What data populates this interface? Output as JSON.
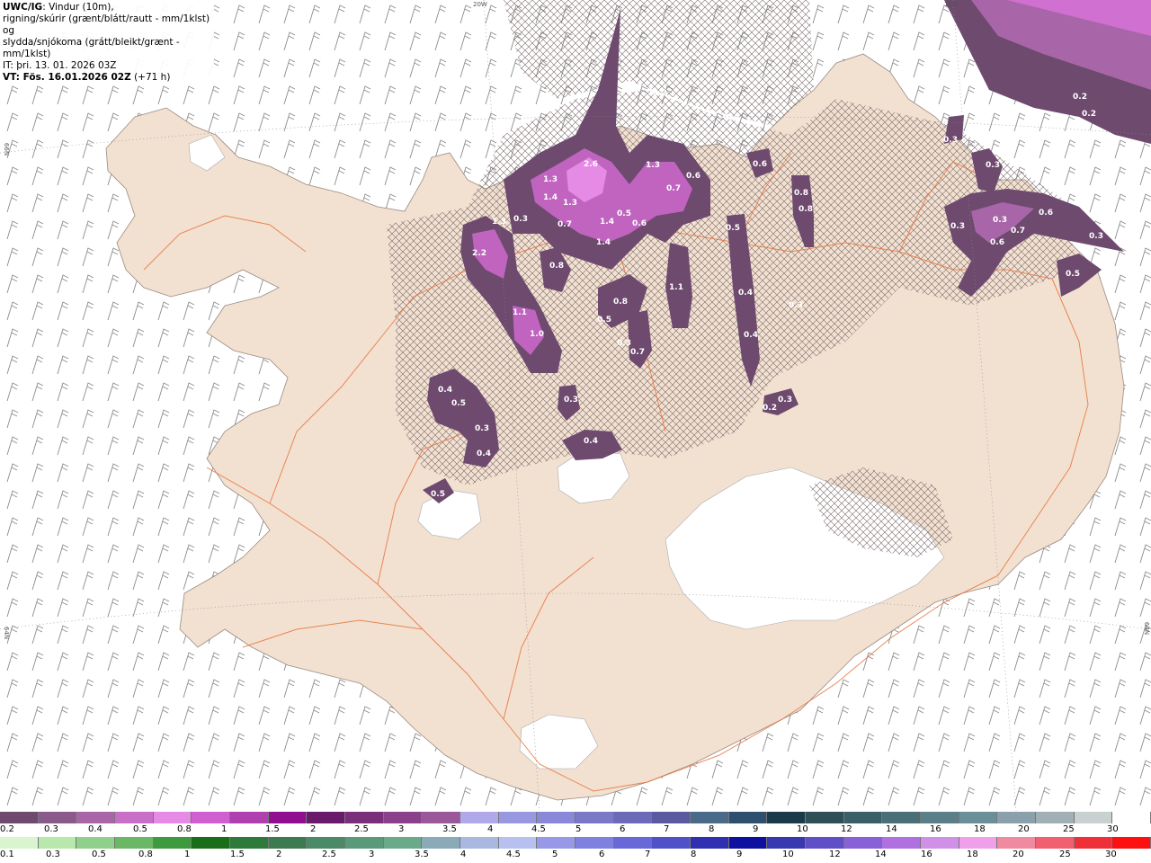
{
  "header": {
    "title_bold": "UWC/IG",
    "title_rest": ": Vindur (10m),",
    "line2": "rigning/skúrir (grænt/blátt/rautt - mm/1klst) og",
    "line3": "slydda/snjókoma (grátt/bleikt/grænt - mm/1klst)",
    "it_label": "IT:",
    "it_value": " þri. 13. 01. 2026 03Z",
    "vt_label": "VT: Fös. 16.01.2026 02Z",
    "vt_value": " (+71 h)"
  },
  "grid_labels": {
    "lon_20w": "20W",
    "lon_15w": "15W",
    "lat_66n": "66N",
    "lat_64n_left": "64N",
    "lat_64n_right": "64N"
  },
  "colors": {
    "land": "#f2e1d1",
    "sea": "#ffffff",
    "roads": "#e8743f",
    "precip_light": "#6e4a6e",
    "precip_mid": "#a855a8",
    "precip_heavy": "#e27be2",
    "barbs": "#666666"
  },
  "precip_labels": [
    {
      "text": "2.6"
    },
    {
      "text": "1.3"
    },
    {
      "text": "1.4"
    },
    {
      "text": "1.3"
    },
    {
      "text": "0.7"
    },
    {
      "text": "1.4"
    },
    {
      "text": "0.5"
    },
    {
      "text": "0.6"
    },
    {
      "text": "1.4"
    },
    {
      "text": "1.3"
    },
    {
      "text": "0.3"
    },
    {
      "text": "2.2"
    },
    {
      "text": "1.3"
    },
    {
      "text": "0.8"
    },
    {
      "text": "1.1"
    },
    {
      "text": "1.0"
    },
    {
      "text": "0.8"
    },
    {
      "text": "0.5"
    },
    {
      "text": "0.3"
    },
    {
      "text": "0.7"
    },
    {
      "text": "1.1"
    },
    {
      "text": "0.6"
    },
    {
      "text": "0.7"
    },
    {
      "text": "0.6"
    },
    {
      "text": "0.8"
    },
    {
      "text": "0.8"
    },
    {
      "text": "0.5"
    },
    {
      "text": "0.4"
    },
    {
      "text": "0.4"
    },
    {
      "text": "0.3"
    },
    {
      "text": "0.4"
    },
    {
      "text": "0.5"
    },
    {
      "text": "0.3"
    },
    {
      "text": "0.4"
    },
    {
      "text": "0.3"
    },
    {
      "text": "0.4"
    },
    {
      "text": "0.2"
    },
    {
      "text": "0.3"
    },
    {
      "text": "0.5"
    },
    {
      "text": "0.2"
    },
    {
      "text": "0.2"
    },
    {
      "text": "0.2"
    },
    {
      "text": "0.3"
    },
    {
      "text": "0.3"
    },
    {
      "text": "0.6"
    },
    {
      "text": "0.7"
    },
    {
      "text": "0.6"
    },
    {
      "text": "0.3"
    },
    {
      "text": "0.5"
    },
    {
      "text": "0.3"
    },
    {
      "text": "0.3"
    },
    {
      "text": "0.2"
    }
  ],
  "colorbar_snow": {
    "colors": [
      "#6e4a6e",
      "#8a5a8a",
      "#a866a8",
      "#c870c8",
      "#e58ae5",
      "#d060d0",
      "#b040b0",
      "#900e90",
      "#6a1a6a",
      "#7a2f7a",
      "#8a408a",
      "#9a579a",
      "#b0a8e8",
      "#9898e0",
      "#8a88d8",
      "#7c78c8",
      "#6a6ab8",
      "#5a5aa0",
      "#4a6a8a",
      "#2f4f6f",
      "#1a3a4a",
      "#2e4f55",
      "#3a5f66",
      "#4a6f77",
      "#5a7f88",
      "#6a8f99",
      "#8aa0aa",
      "#a0b0b5",
      "#c8d0d0",
      "#ffffff"
    ],
    "labels": [
      "0.2",
      "0.3",
      "0.4",
      "0.5",
      "0.8",
      "1",
      "1.5",
      "2",
      "2.5",
      "3",
      "3.5",
      "4",
      "4.5",
      "5",
      "6",
      "7",
      "8",
      "9",
      "10",
      "12",
      "14",
      "16",
      "18",
      "20",
      "25",
      "30"
    ]
  },
  "colorbar_rain": {
    "colors": [
      "#d8f5d0",
      "#b8e8ac",
      "#8fd08a",
      "#6ab866",
      "#3e9a3e",
      "#1a6e1a",
      "#2d7a3a",
      "#3c7a50",
      "#4a8a66",
      "#5a9a7a",
      "#6aaa8a",
      "#8aaab8",
      "#a8b8e0",
      "#b8c0f0",
      "#9898e8",
      "#8080e0",
      "#6868d8",
      "#5050c8",
      "#3030b0",
      "#1010a0",
      "#3838b0",
      "#6050c8",
      "#8a60d8",
      "#b070e0",
      "#d090e8",
      "#f0a0e8",
      "#f08aa0",
      "#f06070",
      "#f03038",
      "#ff1010"
    ],
    "labels": [
      "0.1",
      "0.3",
      "0.5",
      "0.8",
      "1",
      "1.5",
      "2",
      "2.5",
      "3",
      "3.5",
      "4",
      "4.5",
      "5",
      "6",
      "7",
      "8",
      "9",
      "10",
      "12",
      "14",
      "16",
      "18",
      "20",
      "25",
      "30"
    ]
  }
}
